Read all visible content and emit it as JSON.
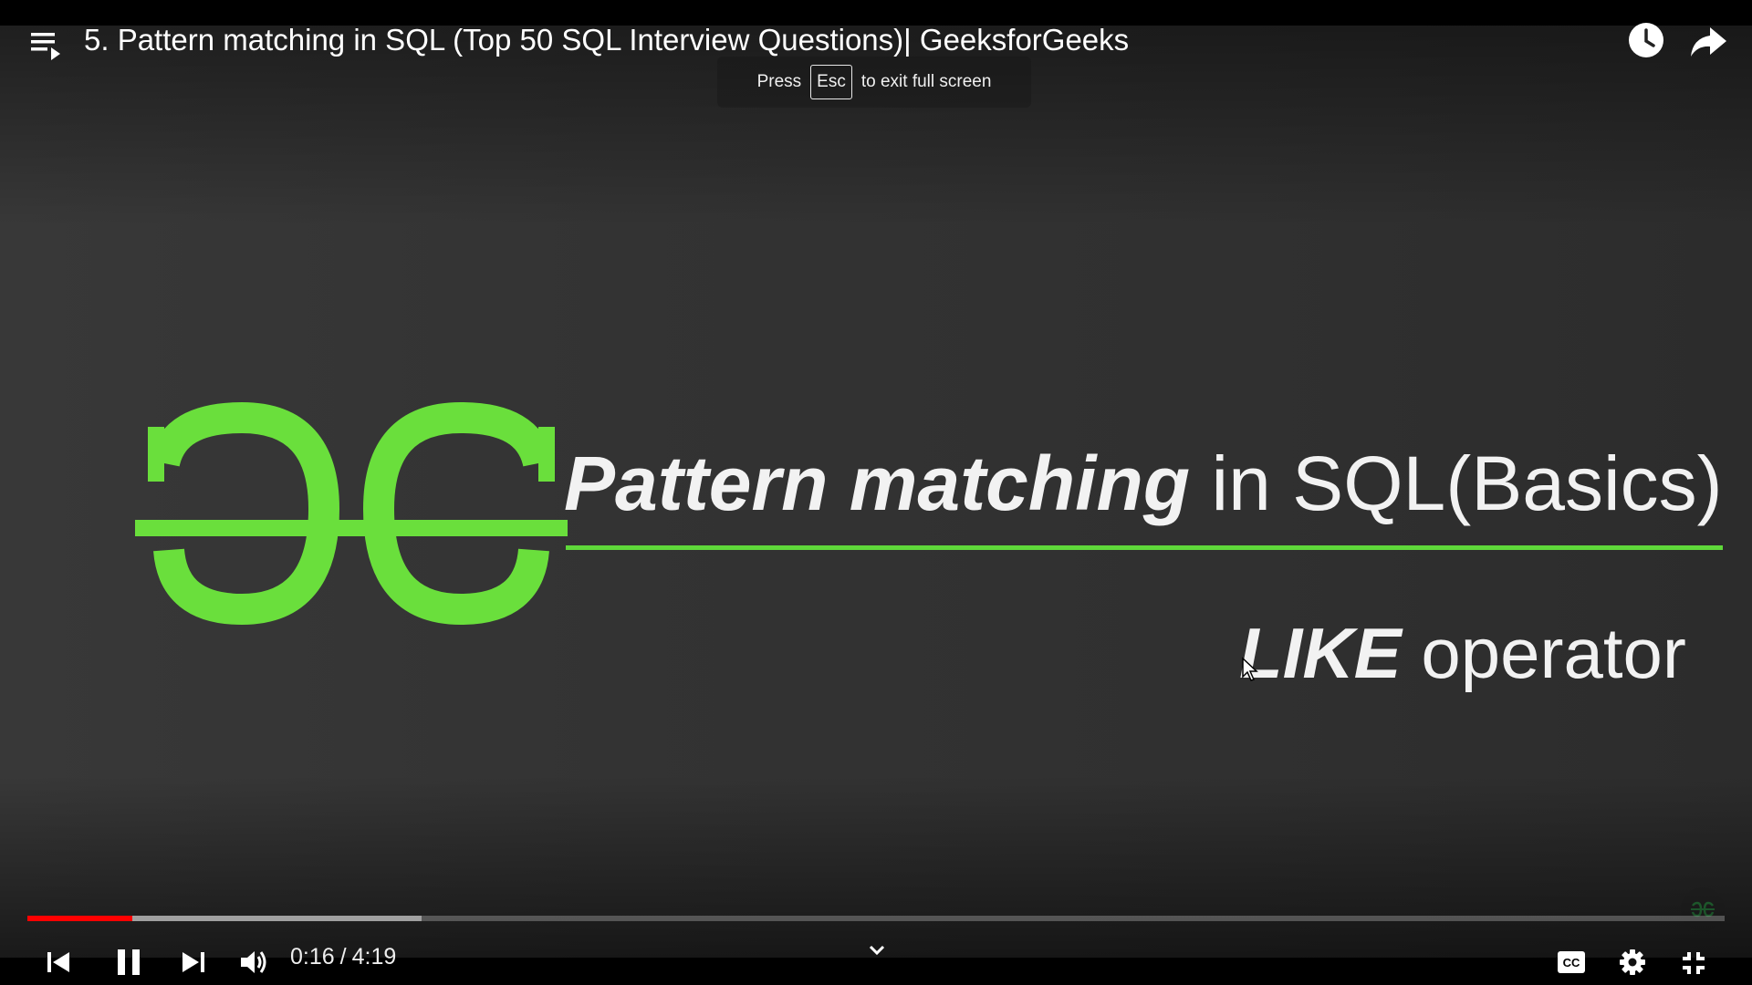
{
  "player": {
    "title": "5. Pattern matching in SQL (Top 50 SQL Interview Questions)| GeeksforGeeks",
    "fullscreen_notice": {
      "prefix": "Press",
      "key": "Esc",
      "suffix": "to exit full screen"
    },
    "current_time": "0:16",
    "time_separator": "/",
    "duration": "4:19",
    "progress_played_fraction": 0.062,
    "progress_buffered_fraction": 0.232,
    "icons": {
      "playlist": "playlist-icon",
      "watch_later": "clock-icon",
      "share": "share-arrow-icon",
      "previous": "skip-previous-icon",
      "pause": "pause-icon",
      "next": "skip-next-icon",
      "volume": "volume-icon",
      "more": "chevron-down-icon",
      "captions": "cc-icon",
      "settings": "gear-icon",
      "exit_fullscreen": "exit-fullscreen-icon"
    },
    "colors": {
      "progress_played": "#ff0000",
      "brand_green": "#5fd83a"
    }
  },
  "slide": {
    "title_emphasis": "Pattern matching",
    "title_rest": " in SQL(Basics)",
    "subtitle_emphasis": "LIKE",
    "subtitle_rest": " operator"
  }
}
